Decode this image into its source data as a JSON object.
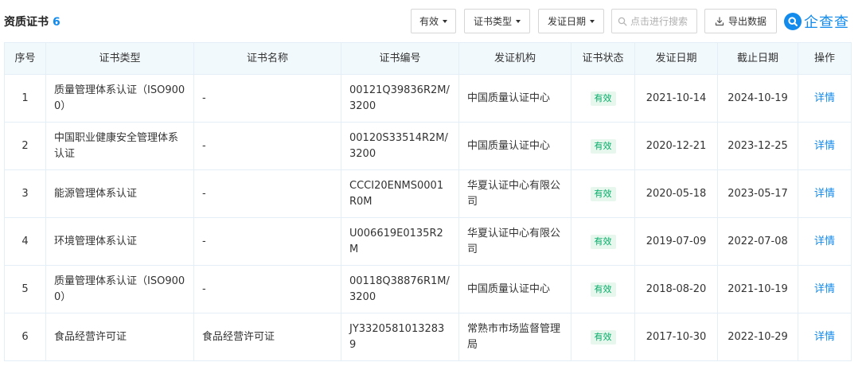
{
  "section": {
    "title": "资质证书",
    "count": "6"
  },
  "toolbar": {
    "filter_valid": "有效",
    "filter_type": "证书类型",
    "filter_date": "发证日期",
    "search_placeholder": "点击进行搜索",
    "export_label": "导出数据"
  },
  "brand": {
    "name": "企查查",
    "color": "#128bed"
  },
  "table": {
    "headers": [
      "序号",
      "证书类型",
      "证书名称",
      "证书编号",
      "发证机构",
      "证书状态",
      "发证日期",
      "截止日期",
      "操作"
    ],
    "rows": [
      {
        "seq": "1",
        "type": "质量管理体系认证（ISO9000）",
        "name": "-",
        "number": "00121Q39836R2M/3200",
        "org": "中国质量认证中心",
        "status": "有效",
        "issue_date": "2021-10-14",
        "expiry_date": "2024-10-19",
        "action": "详情"
      },
      {
        "seq": "2",
        "type": "中国职业健康安全管理体系认证",
        "name": "-",
        "number": "00120S33514R2M/3200",
        "org": "中国质量认证中心",
        "status": "有效",
        "issue_date": "2020-12-21",
        "expiry_date": "2023-12-25",
        "action": "详情"
      },
      {
        "seq": "3",
        "type": "能源管理体系认证",
        "name": "-",
        "number": "CCCI20ENMS0001R0M",
        "org": "华夏认证中心有限公司",
        "status": "有效",
        "issue_date": "2020-05-18",
        "expiry_date": "2023-05-17",
        "action": "详情"
      },
      {
        "seq": "4",
        "type": "环境管理体系认证",
        "name": "-",
        "number": "U006619E0135R2M",
        "org": "华夏认证中心有限公司",
        "status": "有效",
        "issue_date": "2019-07-09",
        "expiry_date": "2022-07-08",
        "action": "详情"
      },
      {
        "seq": "5",
        "type": "质量管理体系认证（ISO9000）",
        "name": "-",
        "number": "00118Q38876R1M/3200",
        "org": "中国质量认证中心",
        "status": "有效",
        "issue_date": "2018-08-20",
        "expiry_date": "2021-10-19",
        "action": "详情"
      },
      {
        "seq": "6",
        "type": "食品经营许可证",
        "name": "食品经营许可证",
        "number": "JY33205810132839",
        "org": "常熟市市场监督管理局",
        "status": "有效",
        "issue_date": "2017-10-30",
        "expiry_date": "2022-10-29",
        "action": "详情"
      }
    ]
  },
  "colors": {
    "accent": "#128bed",
    "header_bg": "#f2f9fc",
    "border": "#e4eef6",
    "status_green": "#00ad65",
    "status_bg": "#e8f7ee"
  },
  "icons": [
    "search-icon",
    "export-icon",
    "qichacha-logo-icon",
    "caret-down-icon"
  ]
}
